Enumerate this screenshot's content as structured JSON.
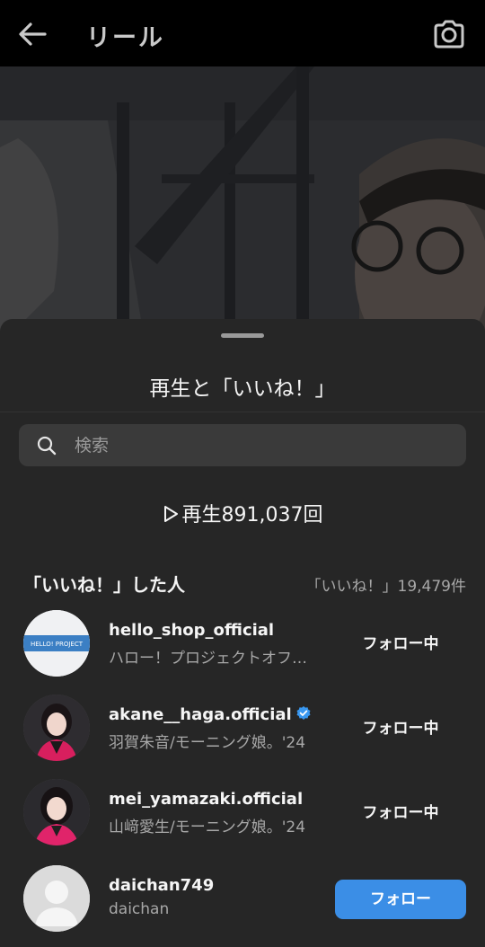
{
  "header": {
    "title": "リール"
  },
  "sheet": {
    "title": "再生と「いいね！」",
    "search_placeholder": "検索",
    "plays_label": "再生891,037回",
    "likes_heading": "「いいね！」した人",
    "likes_count": "「いいね！」19,479件"
  },
  "users": [
    {
      "username": "hello_shop_official",
      "subtitle": "ハロー！プロジェクトオフ…",
      "verified": false,
      "button": "フォロー中",
      "avatar_text": "HELLO! PROJECT"
    },
    {
      "username": "akane__haga.official",
      "subtitle": "羽賀朱音/モーニング娘。'24",
      "verified": true,
      "button": "フォロー中"
    },
    {
      "username": "mei_yamazaki.official",
      "subtitle": "山﨑愛生/モーニング娘。'24",
      "verified": false,
      "button": "フォロー中"
    },
    {
      "username": "daichan749",
      "subtitle": "daichan",
      "verified": false,
      "button": "フォロー"
    }
  ],
  "colors": {
    "accent": "#3b8ee6",
    "sheet_bg": "#262626",
    "verified": "#3897f0"
  }
}
